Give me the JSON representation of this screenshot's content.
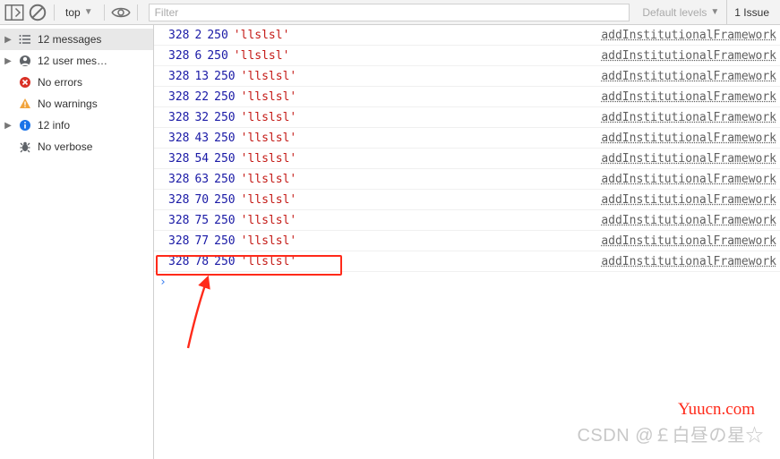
{
  "toolbar": {
    "context": "top",
    "filter_placeholder": "Filter",
    "levels_label": "Default levels",
    "issues_label": "1 Issue"
  },
  "sidebar": {
    "items": [
      {
        "label": "12 messages",
        "hasArrow": true
      },
      {
        "label": "12 user mes…",
        "hasArrow": true
      },
      {
        "label": "No errors",
        "hasArrow": false
      },
      {
        "label": "No warnings",
        "hasArrow": false
      },
      {
        "label": "12 info",
        "hasArrow": true
      },
      {
        "label": "No verbose",
        "hasArrow": false
      }
    ]
  },
  "logs": [
    {
      "n1": "328",
      "n2": "2",
      "n3": "250",
      "s": "'llslsl'",
      "src": "addInstitutionalFramework"
    },
    {
      "n1": "328",
      "n2": "6",
      "n3": "250",
      "s": "'llslsl'",
      "src": "addInstitutionalFramework"
    },
    {
      "n1": "328",
      "n2": "13",
      "n3": "250",
      "s": "'llslsl'",
      "src": "addInstitutionalFramework"
    },
    {
      "n1": "328",
      "n2": "22",
      "n3": "250",
      "s": "'llslsl'",
      "src": "addInstitutionalFramework"
    },
    {
      "n1": "328",
      "n2": "32",
      "n3": "250",
      "s": "'llslsl'",
      "src": "addInstitutionalFramework"
    },
    {
      "n1": "328",
      "n2": "43",
      "n3": "250",
      "s": "'llslsl'",
      "src": "addInstitutionalFramework"
    },
    {
      "n1": "328",
      "n2": "54",
      "n3": "250",
      "s": "'llslsl'",
      "src": "addInstitutionalFramework"
    },
    {
      "n1": "328",
      "n2": "63",
      "n3": "250",
      "s": "'llslsl'",
      "src": "addInstitutionalFramework"
    },
    {
      "n1": "328",
      "n2": "70",
      "n3": "250",
      "s": "'llslsl'",
      "src": "addInstitutionalFramework"
    },
    {
      "n1": "328",
      "n2": "75",
      "n3": "250",
      "s": "'llslsl'",
      "src": "addInstitutionalFramework"
    },
    {
      "n1": "328",
      "n2": "77",
      "n3": "250",
      "s": "'llslsl'",
      "src": "addInstitutionalFramework"
    },
    {
      "n1": "328",
      "n2": "78",
      "n3": "250",
      "s": "'llslsl'",
      "src": "addInstitutionalFramework"
    }
  ],
  "prompt": "›",
  "watermark1": "Yuucn.com",
  "watermark2": "CSDN @￡白昼の星☆"
}
